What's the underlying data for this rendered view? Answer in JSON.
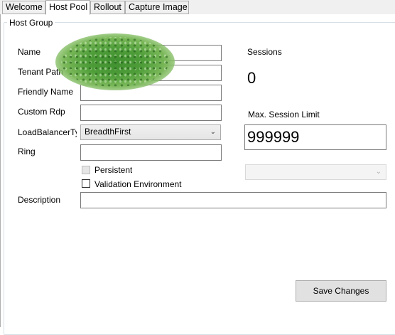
{
  "tabs": [
    {
      "label": "Welcome",
      "active": false
    },
    {
      "label": "Host Pool",
      "active": true
    },
    {
      "label": "Rollout",
      "active": false
    },
    {
      "label": "Capture Image",
      "active": false
    }
  ],
  "group": {
    "title": "Host Group"
  },
  "form": {
    "name_label": "Name",
    "tenant_label": "Tenant Path",
    "friendly_label": "Friendly Name",
    "rdp_label": "Custom Rdp",
    "lb_label": "LoadBalancerTy",
    "lb_value": "BreadthFirst",
    "ring_label": "Ring",
    "persistent_label": "Persistent",
    "validation_label": "Validation Environment",
    "description_label": "Description",
    "name_value": "",
    "tenant_value": "",
    "friendly_value": "",
    "rdp_value": "",
    "ring_value": "",
    "description_value": "",
    "persistent_checked": false,
    "persistent_enabled": false,
    "validation_checked": false
  },
  "sessions": {
    "label": "Sessions",
    "value": "0",
    "max_label": "Max. Session Limit",
    "max_value": "999999",
    "extra_combo_value": ""
  },
  "actions": {
    "save_label": "Save Changes"
  },
  "icons": {
    "dropdown": "chevron-down-icon"
  },
  "colors": {
    "tab_bg": "#f0f0f0",
    "border": "#7a7a7a",
    "button_bg": "#e1e1e1",
    "redaction": "#4f9e3a"
  }
}
